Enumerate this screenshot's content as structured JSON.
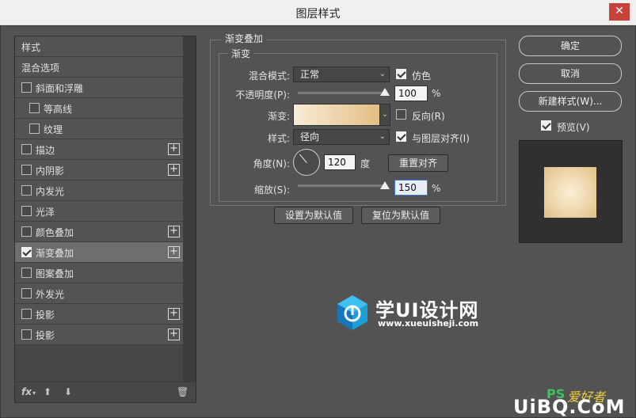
{
  "window": {
    "title": "图层样式",
    "close_icon": "✕"
  },
  "left": {
    "items": [
      {
        "label": "样式",
        "checkbox": false,
        "checked": false,
        "plus": false,
        "indent": 0
      },
      {
        "label": "混合选项",
        "checkbox": false,
        "checked": false,
        "plus": false,
        "indent": 0
      },
      {
        "label": "斜面和浮雕",
        "checkbox": true,
        "checked": false,
        "plus": false,
        "indent": 0
      },
      {
        "label": "等高线",
        "checkbox": true,
        "checked": false,
        "plus": false,
        "indent": 1
      },
      {
        "label": "纹理",
        "checkbox": true,
        "checked": false,
        "plus": false,
        "indent": 1
      },
      {
        "label": "描边",
        "checkbox": true,
        "checked": false,
        "plus": true,
        "indent": 0
      },
      {
        "label": "内阴影",
        "checkbox": true,
        "checked": false,
        "plus": true,
        "indent": 0
      },
      {
        "label": "内发光",
        "checkbox": true,
        "checked": false,
        "plus": false,
        "indent": 0
      },
      {
        "label": "光泽",
        "checkbox": true,
        "checked": false,
        "plus": false,
        "indent": 0
      },
      {
        "label": "颜色叠加",
        "checkbox": true,
        "checked": false,
        "plus": true,
        "indent": 0
      },
      {
        "label": "渐变叠加",
        "checkbox": true,
        "checked": true,
        "plus": true,
        "indent": 0,
        "selected": true
      },
      {
        "label": "图案叠加",
        "checkbox": true,
        "checked": false,
        "plus": false,
        "indent": 0
      },
      {
        "label": "外发光",
        "checkbox": true,
        "checked": false,
        "plus": false,
        "indent": 0
      },
      {
        "label": "投影",
        "checkbox": true,
        "checked": false,
        "plus": true,
        "indent": 0
      },
      {
        "label": "投影",
        "checkbox": true,
        "checked": false,
        "plus": true,
        "indent": 0
      }
    ],
    "bottom": {
      "fx": "fx",
      "fx_caret": "▾",
      "up_icon": "⬆",
      "down_icon": "⬇",
      "trash_icon": "🗑"
    }
  },
  "panel": {
    "outer_legend": "渐变叠加",
    "inner_legend": "渐变",
    "blend_label": "混合模式:",
    "blend_value": "正常",
    "dither_label": "仿色",
    "dither_checked": true,
    "opacity_label": "不透明度(P):",
    "opacity_value": "100",
    "opacity_unit": "%",
    "opacity_level": 1.0,
    "gradient_label": "渐变:",
    "reverse_label": "反向(R)",
    "reverse_checked": false,
    "style_label": "样式:",
    "style_value": "径向",
    "align_label": "与图层对齐(I)",
    "align_checked": true,
    "angle_label": "角度(N):",
    "angle_value": "120",
    "angle_unit": "度",
    "reset_align": "重置对齐",
    "scale_label": "缩放(S):",
    "scale_value": "150",
    "scale_unit": "%",
    "scale_level": 1.0,
    "set_default": "设置为默认值",
    "reset_default": "复位为默认值",
    "arrow": "⌄",
    "gradient_colors": [
      "#f9ecd6",
      "#e3bd84"
    ]
  },
  "right": {
    "ok": "确定",
    "cancel": "取消",
    "new_style": "新建样式(W)...",
    "preview_label": "预览(V)",
    "preview_checked": true
  },
  "watermark": {
    "brand": "学UI设计网",
    "url": "www.xueuisheji.com",
    "brand2_ps": "PS",
    "brand2_cn": "爱好者",
    "brand2_site": "UiBQ.CoM"
  }
}
